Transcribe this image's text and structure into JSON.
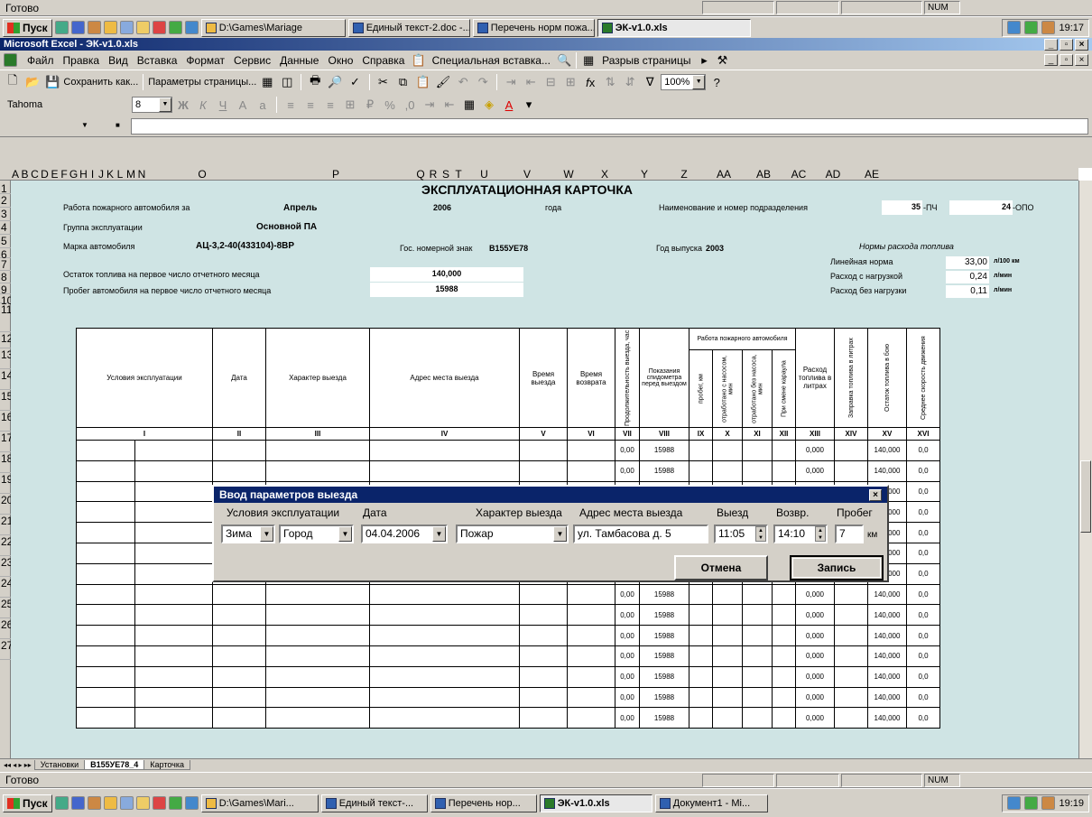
{
  "top_status": {
    "text": "Готово",
    "num": "NUM"
  },
  "taskbar_top": {
    "start": "Пуск",
    "tasks": [
      "D:\\Games\\Mariage",
      "Единый текст-2.doc -...",
      "Перечень норм пожа...",
      "ЭК-v1.0.xls"
    ],
    "clock": "19:17"
  },
  "excel_title": "Microsoft Excel - ЭК-v1.0.xls",
  "menu": [
    "Файл",
    "Правка",
    "Вид",
    "Вставка",
    "Формат",
    "Сервис",
    "Данные",
    "Окно",
    "Справка",
    "Специальная вставка...",
    "Разрыв страницы"
  ],
  "toolbar": {
    "save_as": "Сохранить как...",
    "page_setup": "Параметры страницы...",
    "zoom": "100%"
  },
  "format_bar": {
    "font": "Tahoma",
    "size": "8"
  },
  "columns": [
    "A",
    "B",
    "C",
    "D",
    "E",
    "F",
    "G",
    "H",
    "I",
    "J",
    "K",
    "L",
    "M",
    "N",
    "O",
    "P",
    "Q",
    "R",
    "S",
    "T",
    "U",
    "V",
    "W",
    "X",
    "Y",
    "Z",
    "AA",
    "AB",
    "AC",
    "AD",
    "AE"
  ],
  "rows": [
    "1",
    "2",
    "3",
    "4",
    "5",
    "6",
    "7",
    "8",
    "9",
    "10",
    "11",
    "12",
    "13",
    "14",
    "15",
    "16",
    "17",
    "18",
    "19",
    "20",
    "21",
    "22",
    "23",
    "24",
    "25",
    "26",
    "27"
  ],
  "card": {
    "title": "ЭКСПЛУАТАЦИОННАЯ КАРТОЧКА",
    "work_label": "Работа пожарного автомобиля за",
    "month": "Апрель",
    "year": "2006",
    "year_suffix": "года",
    "unit_label": "Наименование и номер подразделения",
    "unit_no1": "35",
    "unit_suf1": "-ПЧ",
    "unit_no2": "24",
    "unit_suf2": "-ОПО",
    "group_label": "Группа эксплуатации",
    "group_value": "Основной ПА",
    "brand_label": "Марка автомобиля",
    "brand_value": "АЦ-3,2-40(433104)-8ВР",
    "plate_label": "Гос. номерной знак",
    "plate_value": "В155УЕ78",
    "release_label": "Год выпуска",
    "release_value": "2003",
    "norms_label": "Нормы расхода топлива",
    "norm_linear_label": "Линейная норма",
    "norm_linear_value": "33,00",
    "norm_linear_unit": "л/100 км",
    "norm_load_label": "Расход с нагрузкой",
    "norm_load_value": "0,24",
    "norm_load_unit": "л/мин",
    "norm_noload_label": "Расход без нагрузки",
    "norm_noload_value": "0,11",
    "norm_noload_unit": "л/мин",
    "fuel_start_label": "Остаток топлива на первое число отчетного месяца",
    "fuel_start_value": "140,000",
    "mileage_start_label": "Пробег автомобиля на первое число отчетного месяца",
    "mileage_start_value": "15988"
  },
  "table": {
    "headers": [
      "Условия эксплуатации",
      "Дата",
      "Характер выезда",
      "Адрес места выезда",
      "Время выезда",
      "Время возврата",
      "Продолжительность выезда, час",
      "Показания спидометра перед выездом",
      "пробег, км",
      "отработано с насосом, мин",
      "отработано без насоса, мин",
      "При смене караула",
      "Расход топлива в литрах",
      "Заправка топлива в литрах",
      "Остаток топлива в бою",
      "Среднее скорость движения"
    ],
    "group_header": "Работа пожарного автомобиля",
    "roman": [
      "I",
      "II",
      "III",
      "IV",
      "V",
      "VI",
      "VII",
      "VIII",
      "IX",
      "X",
      "XI",
      "XII",
      "XIII",
      "XIV",
      "XV",
      "XVI"
    ],
    "row_values": {
      "duration": "0,00",
      "speedo": "15988",
      "fuel_used": "0,000",
      "fuel_left": "140,000",
      "speed": "0,0"
    }
  },
  "sheet_tabs": [
    "Установки",
    "В155УЕ78_4",
    "Карточка"
  ],
  "dialog": {
    "title": "Ввод параметров выезда",
    "labels": [
      "Условия эксплуатации",
      "Дата",
      "Характер выезда",
      "Адрес места выезда",
      "Выезд",
      "Возвр.",
      "Пробег"
    ],
    "season": "Зима",
    "place": "Город",
    "date": "04.04.2006",
    "nature": "Пожар",
    "address": "ул. Тамбасова д. 5",
    "depart": "11:05",
    "return": "14:10",
    "mileage": "7",
    "mileage_unit": "км",
    "cancel": "Отмена",
    "save": "Запись"
  },
  "bottom_status": {
    "text": "Готово",
    "num": "NUM"
  },
  "taskbar_bottom": {
    "start": "Пуск",
    "tasks": [
      "D:\\Games\\Mari...",
      "Единый текст-...",
      "Перечень нор...",
      "ЭК-v1.0.xls",
      "Документ1 - Mi..."
    ],
    "clock": "19:19"
  }
}
